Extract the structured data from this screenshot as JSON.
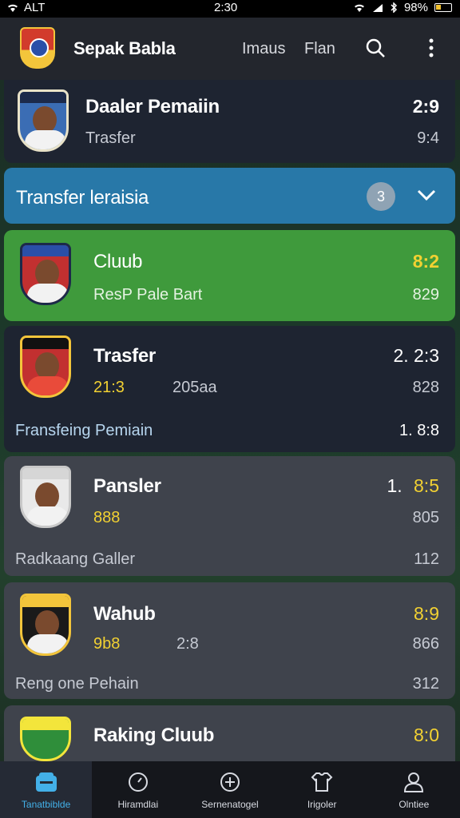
{
  "status": {
    "carrier": "ALT",
    "time": "2:30",
    "battery": "98%"
  },
  "appbar": {
    "title": "Sepak Babla",
    "links": [
      "Imaus",
      "Flan"
    ]
  },
  "cards": [
    {
      "name": "Daaler Pemaiin",
      "sub": "Trasfer",
      "score": "2:9",
      "right_sub": "9:4"
    },
    {
      "name": "Transfer leraisia",
      "badge": "3"
    },
    {
      "name": "Cluub",
      "sub": "ResP Pale Bart",
      "score": "8:2",
      "right_sub": "829"
    },
    {
      "name": "Trasfer",
      "val1": "21:3",
      "val2": "205aa",
      "score": "2. 2:3",
      "right_sub": "828",
      "footer": "Fransfeing Pemiain",
      "footer_right": "1. 8:8"
    },
    {
      "name": "Pansler",
      "val1": "888",
      "score_prefix": "1.",
      "score": "8:5",
      "right_sub": "805",
      "footer": "Radkaang Galler",
      "footer_right": "112"
    },
    {
      "name": "Wahub",
      "val1": "9b8",
      "val2": "2:8",
      "score": "8:9",
      "right_sub": "866",
      "footer": "Reng one  Pehain",
      "footer_right": "312"
    },
    {
      "name": "Raking Cluub",
      "score": "8:0"
    }
  ],
  "bottom_nav": [
    {
      "label": "Tanatbiblde",
      "active": true
    },
    {
      "label": "Hiramdlai",
      "active": false
    },
    {
      "label": "Sernenatogel",
      "active": false
    },
    {
      "label": "Irigoler",
      "active": false
    },
    {
      "label": "Olntiee",
      "active": false
    }
  ],
  "colors": {
    "green_card": "#3f9a3c",
    "blue_card": "#2878a8",
    "accent_yellow": "#f2d132",
    "active_tab": "#43b0e8"
  }
}
